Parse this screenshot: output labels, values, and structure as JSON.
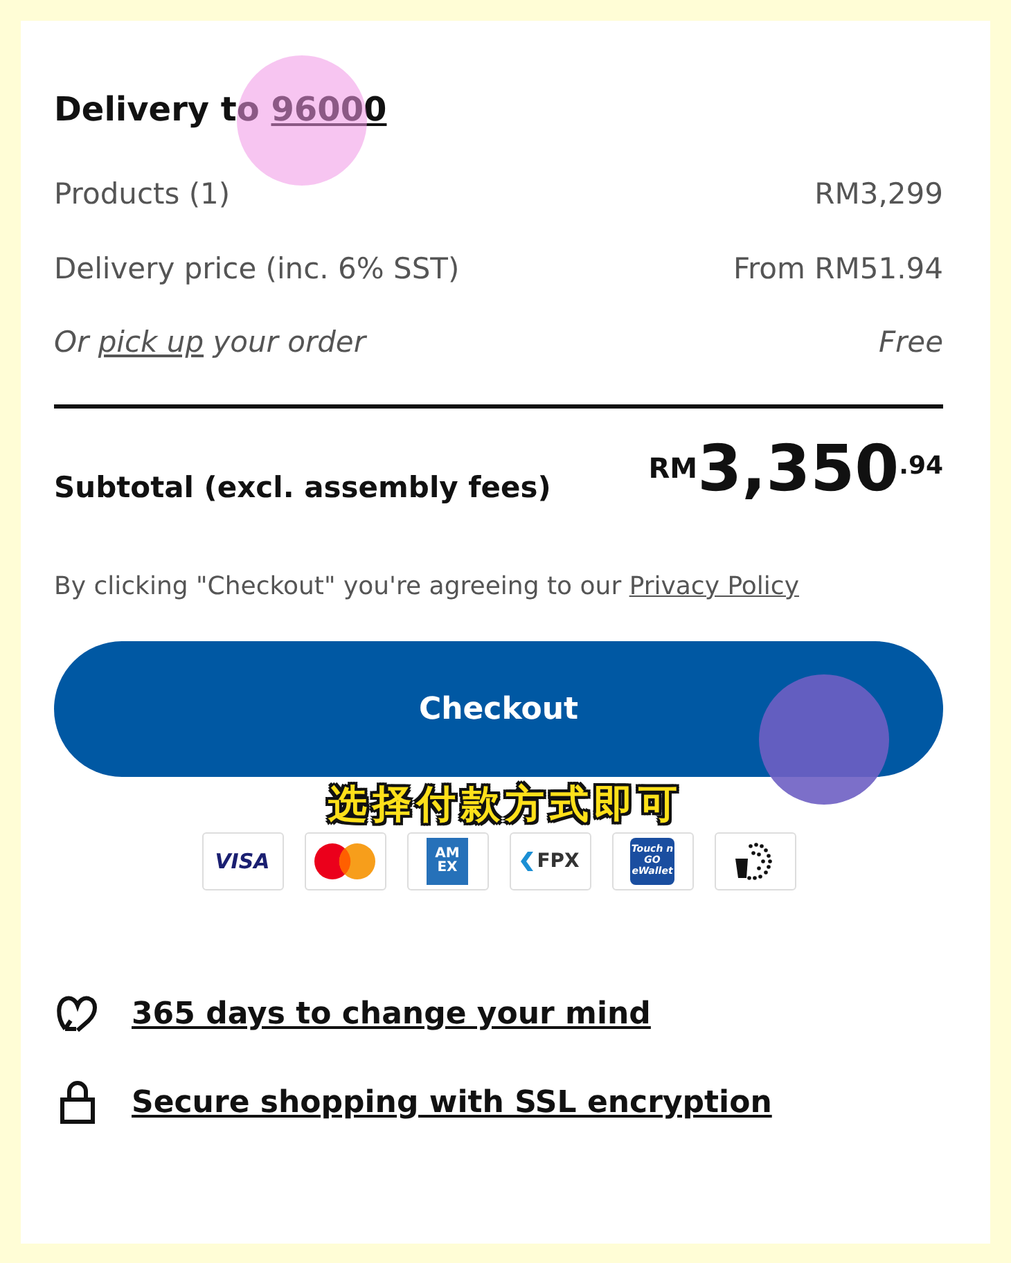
{
  "delivery": {
    "label": "Delivery to",
    "postcode": "96000"
  },
  "summary": [
    {
      "kind": "plain",
      "label": "Products (1)",
      "value": "RM3,299"
    },
    {
      "kind": "plain",
      "label": "Delivery price (inc. 6% SST)",
      "value": "From RM51.94"
    },
    {
      "kind": "pickup",
      "before": "Or",
      "link": "pick up",
      "after": "your order",
      "value": "Free"
    }
  ],
  "subtotal": {
    "label": "Subtotal (excl. assembly fees)",
    "currency": "RM",
    "whole": "3,350",
    "cents": ".94"
  },
  "agreement": {
    "text": "By clicking \"Checkout\" you're agreeing to our",
    "link": "Privacy Policy"
  },
  "checkout_button": "Checkout",
  "caption": "选择付款方式即可",
  "payment_methods": [
    {
      "kind": "visa",
      "label": "VISA"
    },
    {
      "kind": "mastercard"
    },
    {
      "kind": "amex",
      "label": "AM EX"
    },
    {
      "kind": "fpx",
      "label": "FPX"
    },
    {
      "kind": "tng",
      "label": "Touch n GO eWallet"
    },
    {
      "kind": "other"
    }
  ],
  "assurances": [
    {
      "kind": "return",
      "text": "365 days to change your mind"
    },
    {
      "kind": "secure",
      "text": "Secure shopping with SSL encryption"
    }
  ]
}
